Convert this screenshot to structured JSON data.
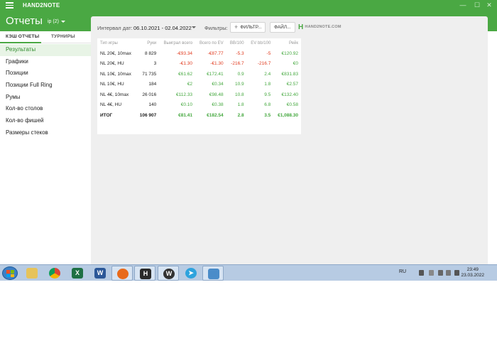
{
  "app": {
    "name": "HAND2NOTE",
    "page_title": "Отчеты",
    "profile": "ip (2)"
  },
  "window_controls": [
    "—",
    "☐",
    "✕"
  ],
  "tabs": [
    {
      "label": "КЭШ ОТЧЕТЫ",
      "active": true
    },
    {
      "label": "ТУРНИРЫ",
      "active": false
    }
  ],
  "sidebar": {
    "items": [
      {
        "label": "Результаты",
        "active": true
      },
      {
        "label": "Графики"
      },
      {
        "label": "Позиции"
      },
      {
        "label": "Позиции Full Ring"
      },
      {
        "label": "Румы"
      },
      {
        "label": "Кол-во столов"
      },
      {
        "label": "Кол-во фишей"
      },
      {
        "label": "Размеры стеков"
      }
    ]
  },
  "filterbar": {
    "date_label": "Интервал дат:",
    "date_range": "06.10.2021 - 02.04.2022",
    "filters_label": "Фильтры:",
    "filter_button": "ФИЛЬТР...",
    "file_button": "ФАЙЛ...",
    "logo_text": "HAND2NOTE.COM"
  },
  "table": {
    "headers": [
      "Тип игры",
      "Руки",
      "Выиграл всего",
      "Всего по EV",
      "BB/100",
      "EV bb/100",
      "Рейк"
    ],
    "rows": [
      [
        "NL 20€, 10max",
        "8 829",
        "-€93.34",
        "-€87.77",
        "-5.3",
        "-5",
        "€120.92"
      ],
      [
        "NL 20€, HU",
        "3",
        "-€1.30",
        "-€1.30",
        "-216.7",
        "-216.7",
        "€0"
      ],
      [
        "NL 10€, 10max",
        "71 735",
        "€61.62",
        "€172.41",
        "0.9",
        "2.4",
        "€831.83"
      ],
      [
        "NL 10€, HU",
        "184",
        "€2",
        "€0.34",
        "10.9",
        "1.8",
        "€2.57"
      ],
      [
        "NL 4€, 10max",
        "26 016",
        "€112.33",
        "€98.48",
        "10.8",
        "9.5",
        "€132.40"
      ],
      [
        "NL 4€, HU",
        "140",
        "€0.10",
        "€0.38",
        "1.8",
        "6.8",
        "€0.58"
      ]
    ],
    "total": [
      "ИТОГ",
      "106 907",
      "€81.41",
      "€182.54",
      "2.8",
      "3.5",
      "€1,088.30"
    ]
  },
  "colors": {
    "accent": "#4aa843",
    "negative": "#e03a1e",
    "positive": "#45a83f"
  },
  "taskbar": {
    "apps": [
      "windows-explorer",
      "chrome",
      "excel",
      "word",
      "firefox",
      "hand2note",
      "app-w",
      "telegram",
      "remote-desktop"
    ],
    "lang": "RU",
    "time": "23:49",
    "date": "23.03.2022"
  }
}
